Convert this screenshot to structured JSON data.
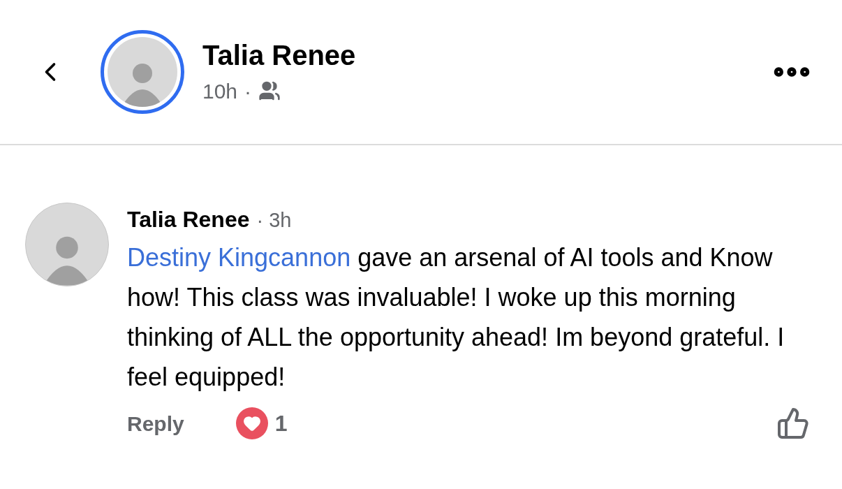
{
  "header": {
    "author": "Talia Renee",
    "time": "10h",
    "separator": "·",
    "story_ring": true
  },
  "comment": {
    "author": "Talia Renee",
    "time": "· 3h",
    "mention": "Destiny Kingcannon",
    "text": " gave an arsenal of AI tools and Know how! This class was invaluable! I woke up this morning thinking of ALL the opportunity ahead! Im beyond grateful. I feel equipped!",
    "reply_label": "Reply",
    "reaction_count": "1"
  }
}
